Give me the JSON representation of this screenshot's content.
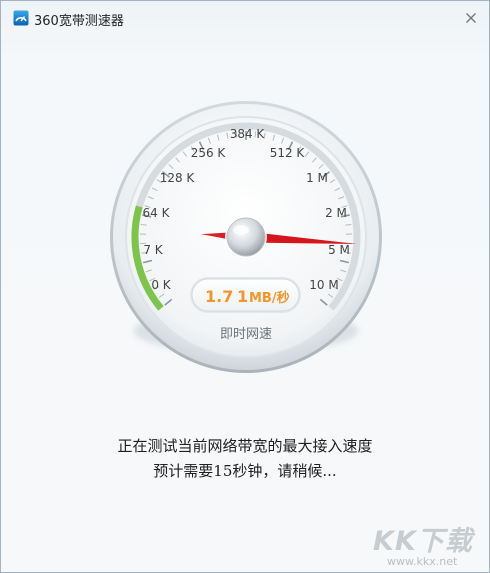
{
  "window": {
    "title": "360宽带测速器",
    "close_symbol": "×"
  },
  "gauge": {
    "ticks": [
      {
        "label": "0 K"
      },
      {
        "label": "7 K"
      },
      {
        "label": "64 K"
      },
      {
        "label": "128 K"
      },
      {
        "label": "256 K"
      },
      {
        "label": "384 K"
      },
      {
        "label": "512 K"
      },
      {
        "label": "1 M"
      },
      {
        "label": "2 M"
      },
      {
        "label": "5 M"
      },
      {
        "label": "10 M"
      }
    ],
    "needle_position_scale": 8.6,
    "speed_value": "1.7",
    "speed_unit_value": "1",
    "speed_unit": "MB/秒",
    "caption": "即时网速",
    "progress_color": "#7cc44a",
    "needle_color": "#d6161d",
    "value_color": "#f0962a"
  },
  "status": {
    "line1": "正在测试当前网络带宽的最大接入速度",
    "line2": "预计需要15秒钟，请稍候..."
  },
  "watermark": {
    "brand": "KK下载",
    "url": "www.kkx.net"
  }
}
